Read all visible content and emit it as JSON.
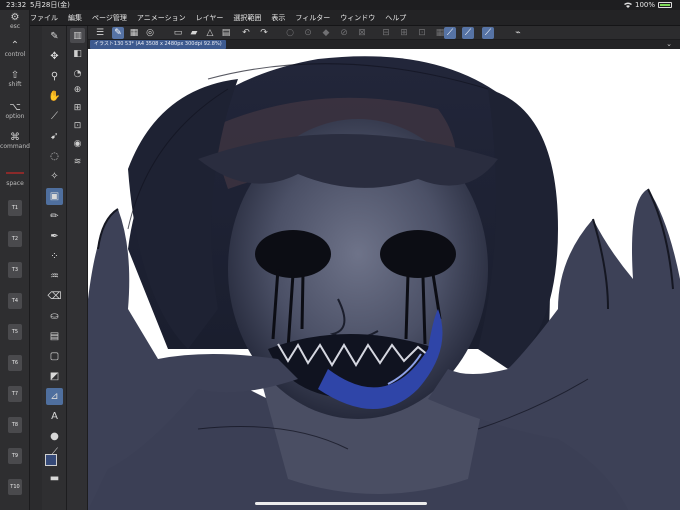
{
  "status": {
    "time": "23:32",
    "date": "5月28日(金)",
    "battery": "100%"
  },
  "menu": {
    "items": [
      "ファイル",
      "編集",
      "ページ管理",
      "アニメーション",
      "レイヤー",
      "選択範囲",
      "表示",
      "フィルター",
      "ウィンドウ",
      "ヘルプ"
    ]
  },
  "modifiers": {
    "esc": "esc",
    "control": "control",
    "shift": "shift",
    "option": "option",
    "command": "command",
    "space": "space",
    "fkeys": [
      "T1",
      "T2",
      "T3",
      "T4",
      "T5",
      "T6",
      "T7",
      "T8",
      "T9",
      "T10"
    ]
  },
  "tab": {
    "label": "イラスト130 53* (A4 3508 x 2480px 300dpi 92.8%)"
  },
  "colors": {
    "accent": "#4f6f9e",
    "main_color": "#364a78",
    "tab_active": "#3d5a8f"
  },
  "icons": {
    "menu": "hamburger-icon",
    "undo": "undo-icon",
    "redo": "redo-icon"
  }
}
